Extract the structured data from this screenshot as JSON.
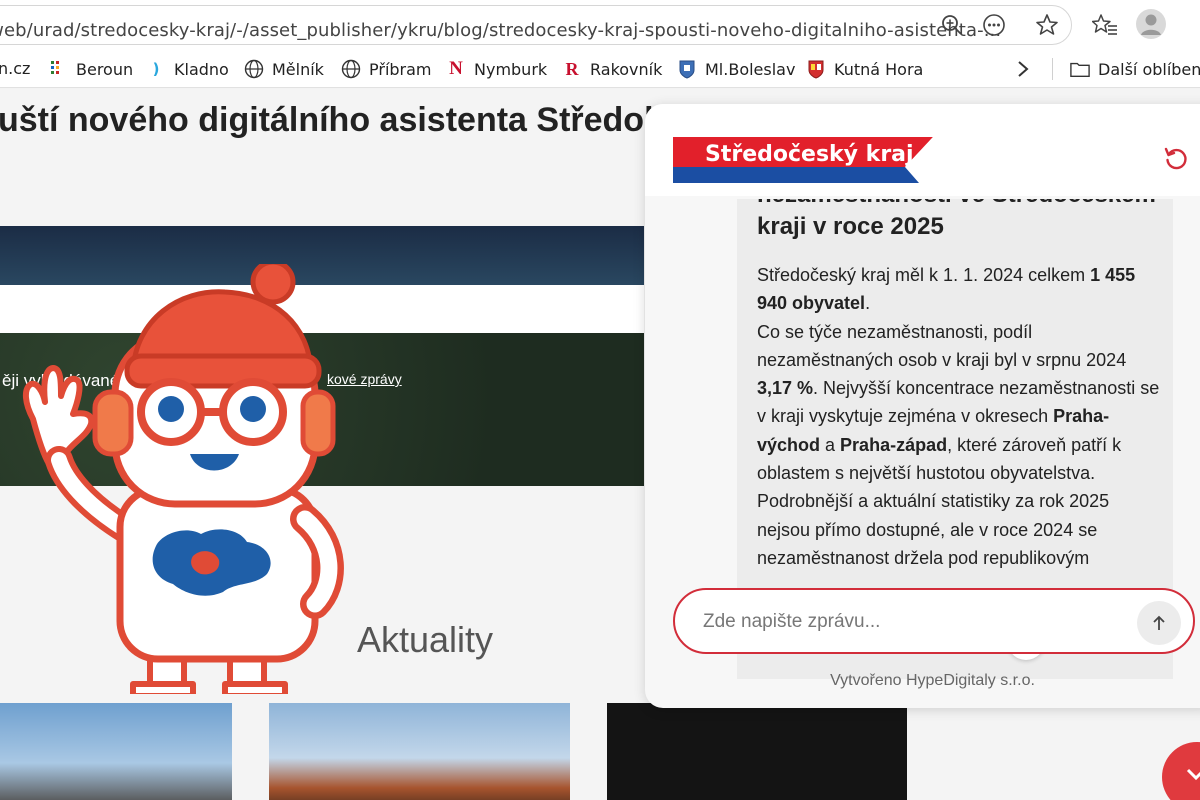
{
  "browser": {
    "url": "/web/urad/stredocesky-kraj/-/asset_publisher/ykru/blog/stredocesky-kraj-spousti-noveho-digitalniho-asistenta-...",
    "bookmarks": [
      {
        "label": "n.cz",
        "icon": ""
      },
      {
        "label": "Beroun",
        "icon": "beroun-favicon"
      },
      {
        "label": "Kladno",
        "icon": "kladno-favicon"
      },
      {
        "label": "Mělník",
        "icon": "globe-icon"
      },
      {
        "label": "Příbram",
        "icon": "globe-icon"
      },
      {
        "label": "Nymburk",
        "icon": "nymburk-favicon"
      },
      {
        "label": "Rakovník",
        "icon": "rakovnik-favicon"
      },
      {
        "label": "Ml.Boleslav",
        "icon": "mlboleslav-favicon"
      },
      {
        "label": "Kutná Hora",
        "icon": "kutnahora-favicon"
      }
    ],
    "other_bookmarks": "Další oblíbené"
  },
  "page": {
    "headline": "uští nového digitálního asistenta Středobot",
    "hero_text": "ěji vyhledávané:",
    "hero_link": "kové zprávy",
    "section_title": "Aktuality"
  },
  "chat": {
    "brand": "Středočeský kraj",
    "message": {
      "title_partial": "nezaměstnanosti ve Středočeském",
      "title": "kraji v roce 2025",
      "p1_a": "Středočeský kraj měl k 1. 1. 2024 celkem ",
      "p1_b": "1 455 940 obyvatel",
      "p1_c": ".",
      "p2_a": "Co se týče nezaměstnanosti, podíl nezaměstnaných osob v kraji byl v srpnu 2024 ",
      "p2_b": "3,17 %",
      "p2_c": ". Nejvyšší koncentrace nezaměstnanosti se v kraji vyskytuje zejména v okresech ",
      "p2_d": "Praha-východ",
      "p2_e": " a ",
      "p2_f": "Praha-západ",
      "p2_g": ", které zároveň patří k oblastem s největší hustotou obyvatelstva.",
      "p3": "Podrobnější a aktuální statistiky za rok 2025 nejsou přímo dostupné, ale v roce 2024 se nezaměstnanost držela pod republikovým"
    },
    "input_placeholder": "Zde napište zprávu...",
    "footer": "Vytvořeno HypeDigitaly s.r.o."
  },
  "colors": {
    "brand_red": "#e2202b",
    "brand_blue": "#1b4ea3",
    "input_border": "#d22d3a"
  }
}
